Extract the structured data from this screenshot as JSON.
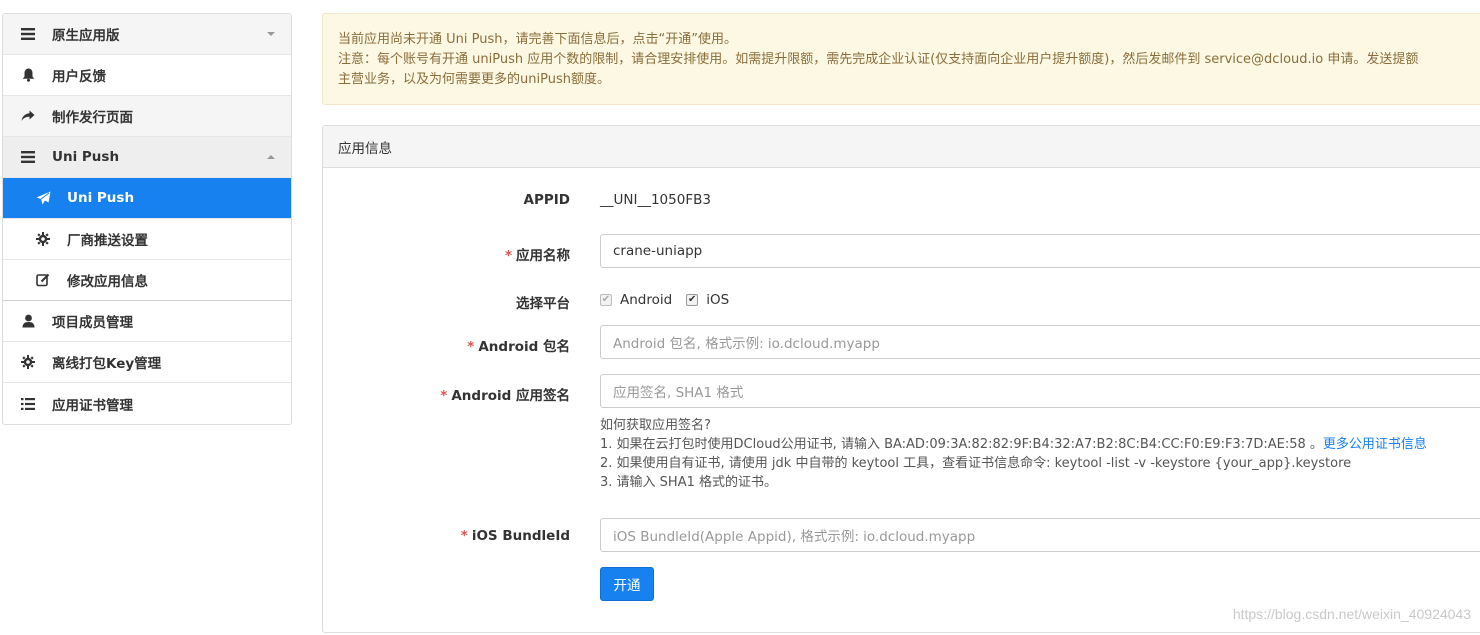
{
  "sidebar": {
    "items": [
      {
        "label": "原生应用版"
      },
      {
        "label": "用户反馈"
      },
      {
        "label": "制作发行页面"
      },
      {
        "label": "Uni Push"
      },
      {
        "label": "Uni Push"
      },
      {
        "label": "厂商推送设置"
      },
      {
        "label": "修改应用信息"
      },
      {
        "label": "项目成员管理"
      },
      {
        "label": "离线打包Key管理"
      },
      {
        "label": "应用证书管理"
      }
    ]
  },
  "alert": {
    "line1": "当前应用尚未开通 Uni Push，请完善下面信息后，点击“开通”使用。",
    "line2": "注意：每个账号有开通 uniPush 应用个数的限制，请合理安排使用。如需提升限额，需先完成企业认证(仅支持面向企业用户提升额度)，然后发邮件到 service@dcloud.io 申请。发送提额",
    "line3": "主营业务，以及为何需要更多的uniPush额度。"
  },
  "panel": {
    "title": "应用信息",
    "required_mark": "*",
    "appid": {
      "label": "APPID",
      "value": "__UNI__1050FB3"
    },
    "app_name": {
      "label": "应用名称",
      "value": "crane-uniapp"
    },
    "platform": {
      "label": "选择平台",
      "android": "Android",
      "ios": "iOS",
      "check_mark": "✔"
    },
    "android_pkg": {
      "label": "Android 包名",
      "placeholder": "Android 包名, 格式示例: io.dcloud.myapp"
    },
    "android_sign": {
      "label": "Android 应用签名",
      "placeholder": "应用签名, SHA1 格式"
    },
    "help": {
      "q": "如何获取应用签名?",
      "l1": "1. 如果在云打包时使用DCloud公用证书, 请输入 BA:AD:09:3A:82:82:9F:B4:32:A7:B2:8C:B4:CC:F0:E9:F3:7D:AE:58 。",
      "l1_link": "更多公用证书信息",
      "l2": "2. 如果使用自有证书, 请使用 jdk 中自带的 keytool 工具，查看证书信息命令: keytool -list -v -keystore {your_app}.keystore",
      "l3": "3. 请输入 SHA1 格式的证书。"
    },
    "ios_bundle": {
      "label": "iOS BundleId",
      "placeholder": "iOS BundleId(Apple Appid), 格式示例: io.dcloud.myapp"
    },
    "submit_label": "开通"
  },
  "watermark": "https://blog.csdn.net/weixin_40924043",
  "colors": {
    "accent": "#1781f0",
    "alert_bg": "#fcf8e3",
    "alert_text": "#8a6d3b",
    "required": "#d9534f"
  }
}
